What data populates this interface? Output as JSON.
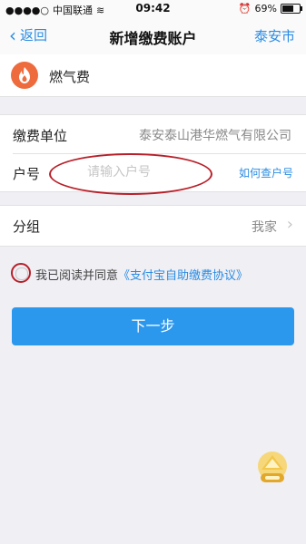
{
  "status_bar": {
    "carrier": "中国联通",
    "time": "09:42",
    "battery": "69%",
    "battery_level": 0.69
  },
  "nav": {
    "back_label": "返回",
    "title": "新增缴费账户",
    "city": "泰安市"
  },
  "bill_type": {
    "icon": "flame-icon",
    "label": "燃气费"
  },
  "form": {
    "unit_label": "缴费单位",
    "unit_value": "泰安泰山港华燃气有限公司",
    "account_label": "户号",
    "account_placeholder": "请输入户号",
    "account_value": "",
    "how_link": "如何查户号"
  },
  "group": {
    "label": "分组",
    "value": "我家"
  },
  "agreement": {
    "prefix": "我已阅读并同意",
    "link": "《支付宝自助缴费协议》",
    "checked": false
  },
  "next_button": "下一步",
  "colors": {
    "accent": "#2b8ce3",
    "button": "#2b98ee",
    "annotation_red": "#b8202a",
    "gas_icon": "#ee6b3d"
  }
}
